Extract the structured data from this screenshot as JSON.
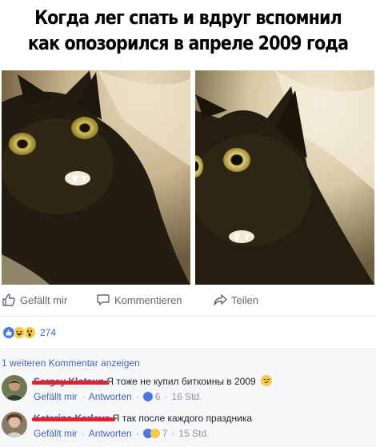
{
  "meme": {
    "caption_line1": "Когда лег спать и вдруг вспомнил",
    "caption_line2": "как опозорился в апреле 2009 года"
  },
  "actions": {
    "like_label": "Gefällt mir",
    "comment_label": "Kommentieren",
    "share_label": "Teilen"
  },
  "reactions": {
    "icons": [
      "like",
      "haha",
      "wow"
    ],
    "count": "274",
    "colors": {
      "like": "#4a76e8",
      "haha": "#f7c948",
      "wow": "#f7c948"
    }
  },
  "comments": {
    "more_label": "1 weiteren Kommentar anzeigen",
    "items": [
      {
        "author": "Sergey Klotsun",
        "text": "Я тоже не купил биткоины в 2009",
        "like_label": "Gefällt mir",
        "reply_label": "Antworten",
        "reaction_count": "6",
        "time": "16 Std."
      },
      {
        "author": "Katerina Karlova",
        "text": "Я так после каждого праздника",
        "like_label": "Gefällt mir",
        "reply_label": "Antworten",
        "reaction_count": "7",
        "time": "15 Std."
      }
    ]
  }
}
